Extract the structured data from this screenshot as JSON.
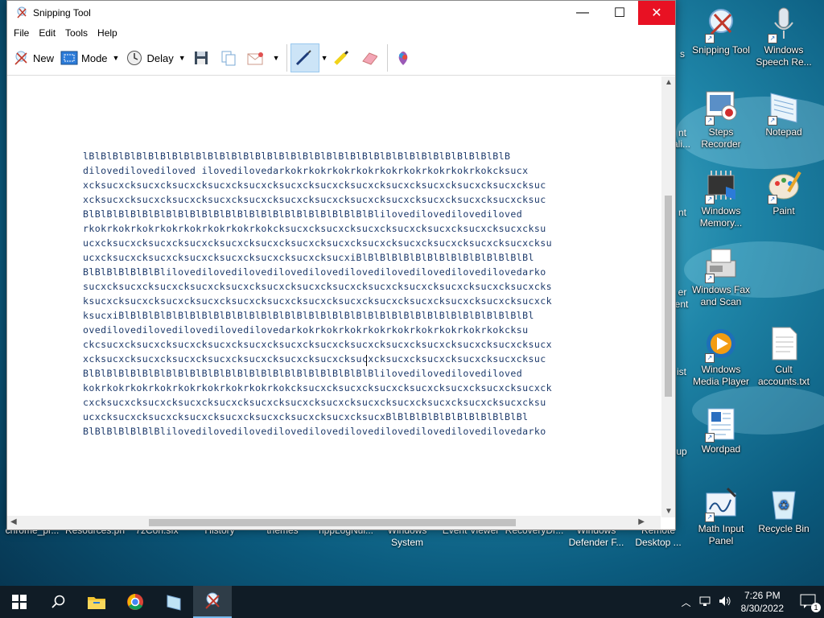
{
  "window": {
    "title": "Snipping Tool",
    "minimize": "—",
    "maximize": "☐",
    "close": "✕"
  },
  "menu": [
    "File",
    "Edit",
    "Tools",
    "Help"
  ],
  "toolbar": {
    "new_label": "New",
    "mode_label": "Mode",
    "delay_label": "Delay"
  },
  "snip_text": [
    "lBlBlBlBlBlBlBlBlBlBlBlBlBlBlBlBlBlBlBlBlBlBlBlBlBlBlBlBlBlBlBlBlBlBlBlB",
    "dilovedilovediloved ilovedilovedarkokrkokrkokrkokrkokrkokrkokrkokrkokcksucx",
    "xcksucxcksucxcksucxcksucxcksucxcksucxcksucxcksucxcksucxcksucxcksucxcksucxcksuc",
    "xcksucxcksucxcksucxcksucxcksucxcksucxcksucxcksucxcksucxcksucxcksucxcksucxcksuc",
    "BlBlBlBlBlBlBlBlBlBlBlBlBlBlBlBlBlBlBlBlBlBlBlBlBlilovedilovedilovediloved",
    "rkokrkokrkokrkokrkokrkokrkokrkokcksucxcksucxcksucxcksucxcksucxcksucxcksucxcksu",
    "ucxcksucxcksucxcksucxcksucxcksucxcksucxcksucxcksucxcksucxcksucxcksucxcksucxcksu",
    "ucxcksucxcksucxcksucxcksucxcksucxcksucxcksucxiBlBlBlBlBlBlBlBlBlBlBlBlBlBlBl",
    "BlBlBlBlBlBlBlilovedilovedilovedilovedilovedilovedilovedilovedilovedilovedarko",
    "sucxcksucxcksucxcksucxcksucxcksucxcksucxcksucxcksucxcksucxcksucxcksucxcksucxcks",
    "ksucxcksucxcksucxcksucxcksucxcksucxcksucxcksucxcksucxcksucxcksucxcksucxcksucxck",
    "ksucxiBlBlBlBlBlBlBlBlBlBlBlBlBlBlBlBlBlBlBlBlBlBlBlBlBlBlBlBlBlBlBlBlBlBlBl",
    "ovedilovedilovedilovedilovedilovedarkokrkokrkokrkokrkokrkokrkokrkokrkokcksu",
    "ckcsucxcksucxcksucxcksucxcksucxcksucxcksucxcksucxcksucxcksucxcksucxcksucxcksucx",
    "xcksucxcksucxcksucxcksucxcksucxcksucxcksucxcksucxcksucxcksucxcksucxcksucxcksuc",
    "BlBlBlBlBlBlBlBlBlBlBlBlBlBlBlBlBlBlBlBlBlBlBlBlBlilovedilovedilovediloved",
    "kokrkokrkokrkokrkokrkokrkokrkokrkokcksucxcksucxcksucxcksucxcksucxcksucxcksucxck",
    "cxcksucxcksucxcksucxcksucxcksucxcksucxcksucxcksucxcksucxcksucxcksucxcksucxcksu",
    "ucxcksucxcksucxcksucxcksucxcksucxcksucxcksucxcksucxBlBlBlBlBlBlBlBlBlBlBlBl",
    "BlBlBlBlBlBlBlilovedilovedilovedilovedilovedilovedilovedilovedilovedilovedarko"
  ],
  "desktop_icons": [
    {
      "label": "Snipping Tool"
    },
    {
      "label": "Windows Speech Re..."
    },
    {
      "label": "Steps Recorder"
    },
    {
      "label": "Notepad"
    },
    {
      "label": "Windows Memory..."
    },
    {
      "label": "Paint"
    },
    {
      "label": "Windows Fax and Scan"
    },
    {
      "label": "Windows Media Player"
    },
    {
      "label": "Cult accounts.txt"
    },
    {
      "label": "Wordpad"
    },
    {
      "label": "Math Input Panel"
    },
    {
      "label": "Recycle Bin"
    }
  ],
  "bottom_icons": [
    "chrome_pr...",
    "Resources.ph",
    "7zCon.sfx",
    "History",
    "themes",
    "nppLogNul...",
    "Windows System",
    "Event Viewer",
    "RecoveryDr...",
    "Windows Defender F...",
    "Remote Desktop ..."
  ],
  "partial_labels": [
    "s",
    "nt",
    "ali...",
    "nt",
    "er",
    "ent",
    "ist",
    "up"
  ],
  "taskbar": {
    "time": "7:26 PM",
    "date": "8/30/2022",
    "notification_count": "1"
  },
  "colors": {
    "title_close": "#e81123",
    "taskbar": "#101c26",
    "snip_text": "#1d3a6b"
  }
}
